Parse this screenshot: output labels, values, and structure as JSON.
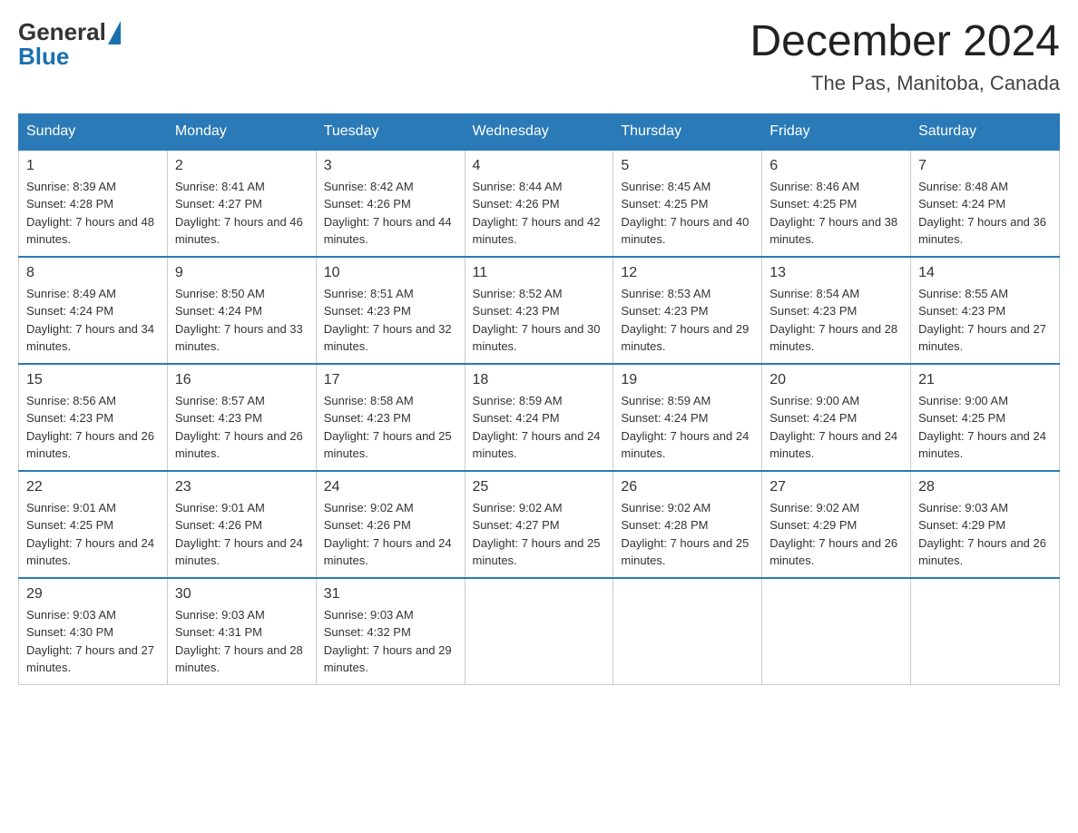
{
  "logo": {
    "text_general": "General",
    "text_blue": "Blue"
  },
  "title": {
    "month": "December 2024",
    "location": "The Pas, Manitoba, Canada"
  },
  "weekdays": [
    "Sunday",
    "Monday",
    "Tuesday",
    "Wednesday",
    "Thursday",
    "Friday",
    "Saturday"
  ],
  "weeks": [
    [
      {
        "day": "1",
        "sunrise": "8:39 AM",
        "sunset": "4:28 PM",
        "daylight": "7 hours and 48 minutes."
      },
      {
        "day": "2",
        "sunrise": "8:41 AM",
        "sunset": "4:27 PM",
        "daylight": "7 hours and 46 minutes."
      },
      {
        "day": "3",
        "sunrise": "8:42 AM",
        "sunset": "4:26 PM",
        "daylight": "7 hours and 44 minutes."
      },
      {
        "day": "4",
        "sunrise": "8:44 AM",
        "sunset": "4:26 PM",
        "daylight": "7 hours and 42 minutes."
      },
      {
        "day": "5",
        "sunrise": "8:45 AM",
        "sunset": "4:25 PM",
        "daylight": "7 hours and 40 minutes."
      },
      {
        "day": "6",
        "sunrise": "8:46 AM",
        "sunset": "4:25 PM",
        "daylight": "7 hours and 38 minutes."
      },
      {
        "day": "7",
        "sunrise": "8:48 AM",
        "sunset": "4:24 PM",
        "daylight": "7 hours and 36 minutes."
      }
    ],
    [
      {
        "day": "8",
        "sunrise": "8:49 AM",
        "sunset": "4:24 PM",
        "daylight": "7 hours and 34 minutes."
      },
      {
        "day": "9",
        "sunrise": "8:50 AM",
        "sunset": "4:24 PM",
        "daylight": "7 hours and 33 minutes."
      },
      {
        "day": "10",
        "sunrise": "8:51 AM",
        "sunset": "4:23 PM",
        "daylight": "7 hours and 32 minutes."
      },
      {
        "day": "11",
        "sunrise": "8:52 AM",
        "sunset": "4:23 PM",
        "daylight": "7 hours and 30 minutes."
      },
      {
        "day": "12",
        "sunrise": "8:53 AM",
        "sunset": "4:23 PM",
        "daylight": "7 hours and 29 minutes."
      },
      {
        "day": "13",
        "sunrise": "8:54 AM",
        "sunset": "4:23 PM",
        "daylight": "7 hours and 28 minutes."
      },
      {
        "day": "14",
        "sunrise": "8:55 AM",
        "sunset": "4:23 PM",
        "daylight": "7 hours and 27 minutes."
      }
    ],
    [
      {
        "day": "15",
        "sunrise": "8:56 AM",
        "sunset": "4:23 PM",
        "daylight": "7 hours and 26 minutes."
      },
      {
        "day": "16",
        "sunrise": "8:57 AM",
        "sunset": "4:23 PM",
        "daylight": "7 hours and 26 minutes."
      },
      {
        "day": "17",
        "sunrise": "8:58 AM",
        "sunset": "4:23 PM",
        "daylight": "7 hours and 25 minutes."
      },
      {
        "day": "18",
        "sunrise": "8:59 AM",
        "sunset": "4:24 PM",
        "daylight": "7 hours and 24 minutes."
      },
      {
        "day": "19",
        "sunrise": "8:59 AM",
        "sunset": "4:24 PM",
        "daylight": "7 hours and 24 minutes."
      },
      {
        "day": "20",
        "sunrise": "9:00 AM",
        "sunset": "4:24 PM",
        "daylight": "7 hours and 24 minutes."
      },
      {
        "day": "21",
        "sunrise": "9:00 AM",
        "sunset": "4:25 PM",
        "daylight": "7 hours and 24 minutes."
      }
    ],
    [
      {
        "day": "22",
        "sunrise": "9:01 AM",
        "sunset": "4:25 PM",
        "daylight": "7 hours and 24 minutes."
      },
      {
        "day": "23",
        "sunrise": "9:01 AM",
        "sunset": "4:26 PM",
        "daylight": "7 hours and 24 minutes."
      },
      {
        "day": "24",
        "sunrise": "9:02 AM",
        "sunset": "4:26 PM",
        "daylight": "7 hours and 24 minutes."
      },
      {
        "day": "25",
        "sunrise": "9:02 AM",
        "sunset": "4:27 PM",
        "daylight": "7 hours and 25 minutes."
      },
      {
        "day": "26",
        "sunrise": "9:02 AM",
        "sunset": "4:28 PM",
        "daylight": "7 hours and 25 minutes."
      },
      {
        "day": "27",
        "sunrise": "9:02 AM",
        "sunset": "4:29 PM",
        "daylight": "7 hours and 26 minutes."
      },
      {
        "day": "28",
        "sunrise": "9:03 AM",
        "sunset": "4:29 PM",
        "daylight": "7 hours and 26 minutes."
      }
    ],
    [
      {
        "day": "29",
        "sunrise": "9:03 AM",
        "sunset": "4:30 PM",
        "daylight": "7 hours and 27 minutes."
      },
      {
        "day": "30",
        "sunrise": "9:03 AM",
        "sunset": "4:31 PM",
        "daylight": "7 hours and 28 minutes."
      },
      {
        "day": "31",
        "sunrise": "9:03 AM",
        "sunset": "4:32 PM",
        "daylight": "7 hours and 29 minutes."
      },
      null,
      null,
      null,
      null
    ]
  ]
}
